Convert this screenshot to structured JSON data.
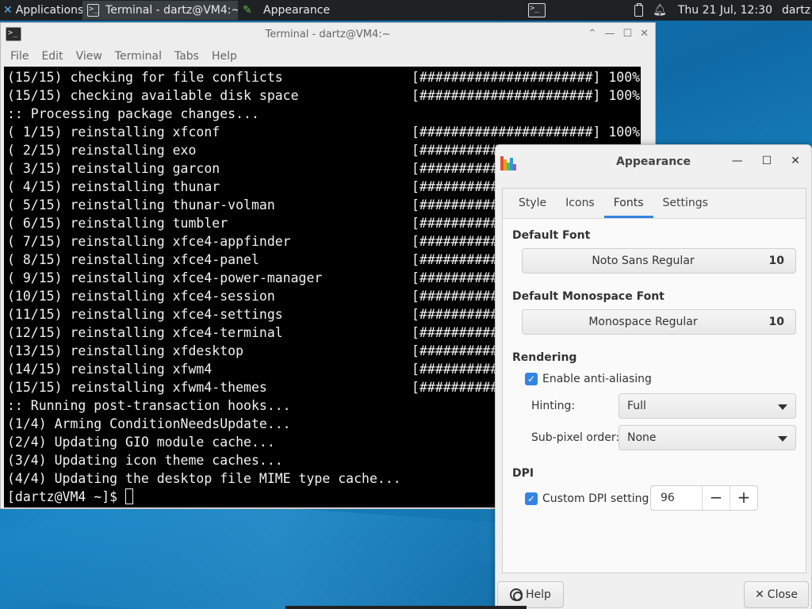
{
  "panel": {
    "applications_label": "Applications",
    "tasks": [
      {
        "label": "Terminal - dartz@VM4:~",
        "icon": "terminal-icon"
      },
      {
        "label": "Appearance",
        "icon": "appearance-icon"
      }
    ],
    "clock": "Thu 21 Jul, 12:30",
    "user": "dartz"
  },
  "terminal": {
    "title": "Terminal - dartz@VM4:~",
    "menu": [
      "File",
      "Edit",
      "View",
      "Terminal",
      "Tabs",
      "Help"
    ],
    "lines": [
      {
        "text": "(15/15) checking for file conflicts",
        "progress": "[######################] 100%"
      },
      {
        "text": "(15/15) checking available disk space",
        "progress": "[######################] 100%"
      },
      {
        "text": ":: Processing package changes...",
        "progress": ""
      },
      {
        "text": "( 1/15) reinstalling xfconf",
        "progress": "[######################] 100%"
      },
      {
        "text": "( 2/15) reinstalling exo",
        "progress": "[##########"
      },
      {
        "text": "( 3/15) reinstalling garcon",
        "progress": "[##########"
      },
      {
        "text": "( 4/15) reinstalling thunar",
        "progress": "[##########"
      },
      {
        "text": "( 5/15) reinstalling thunar-volman",
        "progress": "[##########"
      },
      {
        "text": "( 6/15) reinstalling tumbler",
        "progress": "[##########"
      },
      {
        "text": "( 7/15) reinstalling xfce4-appfinder",
        "progress": "[##########"
      },
      {
        "text": "( 8/15) reinstalling xfce4-panel",
        "progress": "[##########"
      },
      {
        "text": "( 9/15) reinstalling xfce4-power-manager",
        "progress": "[##########"
      },
      {
        "text": "(10/15) reinstalling xfce4-session",
        "progress": "[##########"
      },
      {
        "text": "(11/15) reinstalling xfce4-settings",
        "progress": "[##########"
      },
      {
        "text": "(12/15) reinstalling xfce4-terminal",
        "progress": "[##########"
      },
      {
        "text": "(13/15) reinstalling xfdesktop",
        "progress": "[##########"
      },
      {
        "text": "(14/15) reinstalling xfwm4",
        "progress": "[##########"
      },
      {
        "text": "(15/15) reinstalling xfwm4-themes",
        "progress": "[##########"
      },
      {
        "text": ":: Running post-transaction hooks...",
        "progress": ""
      },
      {
        "text": "(1/4) Arming ConditionNeedsUpdate...",
        "progress": ""
      },
      {
        "text": "(2/4) Updating GIO module cache...",
        "progress": ""
      },
      {
        "text": "(3/4) Updating icon theme caches...",
        "progress": ""
      },
      {
        "text": "(4/4) Updating the desktop file MIME type cache...",
        "progress": ""
      }
    ],
    "prompt": "[dartz@VM4 ~]$ "
  },
  "appearance": {
    "title": "Appearance",
    "tabs": [
      {
        "label": "Style",
        "active": false
      },
      {
        "label": "Icons",
        "active": false
      },
      {
        "label": "Fonts",
        "active": true
      },
      {
        "label": "Settings",
        "active": false
      }
    ],
    "default_font": {
      "heading": "Default Font",
      "name": "Noto Sans Regular",
      "size": "10"
    },
    "mono_font": {
      "heading": "Default Monospace Font",
      "name": "Monospace Regular",
      "size": "10"
    },
    "rendering": {
      "heading": "Rendering",
      "antialias_label": "Enable anti-aliasing",
      "antialias_checked": true,
      "hinting_label": "Hinting:",
      "hinting_value": "Full",
      "subpixel_label": "Sub-pixel order:",
      "subpixel_value": "None"
    },
    "dpi": {
      "heading": "DPI",
      "custom_label": "Custom DPI setting:",
      "custom_checked": true,
      "value": "96",
      "minus": "−",
      "plus": "+"
    },
    "help_label": "Help",
    "close_label": "Close"
  },
  "colors": {
    "accent": "#3584e4",
    "terminal_bg": "#000000",
    "panel_bg": "#1e2225"
  }
}
